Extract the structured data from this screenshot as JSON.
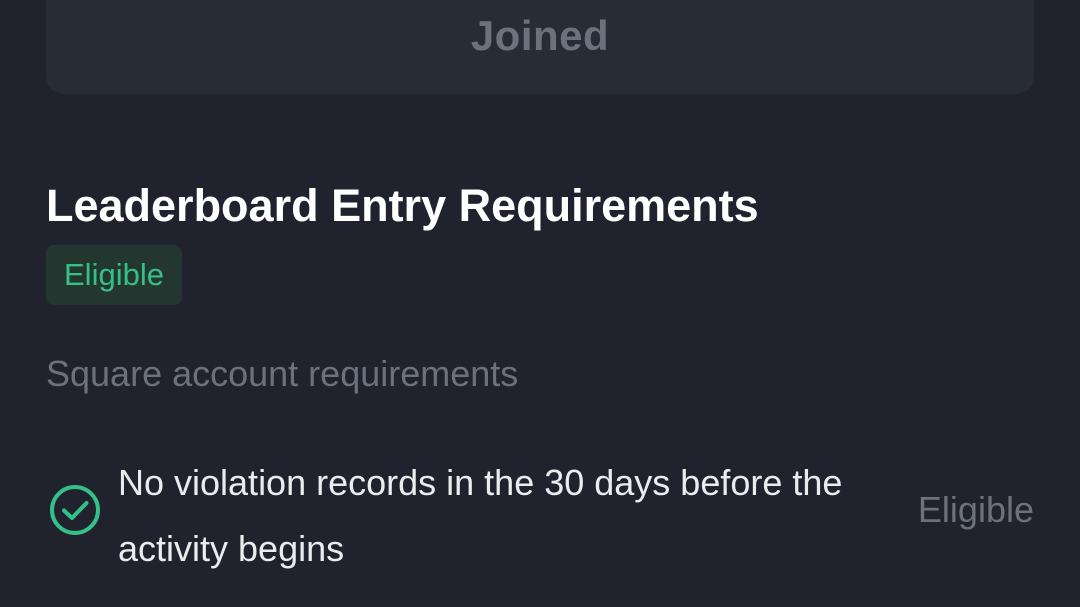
{
  "joined_button": {
    "label": "Joined"
  },
  "section": {
    "title": "Leaderboard Entry Requirements",
    "status_badge": "Eligible",
    "status_color": "#35c08a"
  },
  "square_account": {
    "heading": "Square account requirements",
    "requirements": [
      {
        "text": "No violation records in the 30 days before the activity begins",
        "status": "Eligible",
        "icon": "check-circle-icon"
      }
    ]
  }
}
